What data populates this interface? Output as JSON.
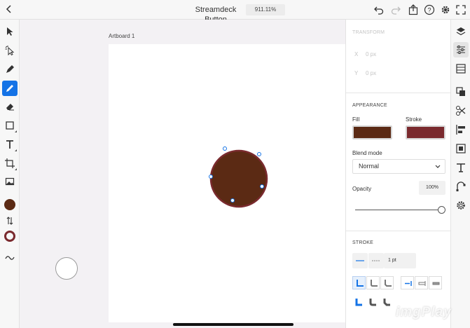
{
  "header": {
    "title": "Streamdeck Button",
    "zoom": "911.11%"
  },
  "canvas": {
    "artboard_label": "Artboard 1"
  },
  "colors": {
    "fill": "#5b2a14",
    "stroke": "#7a2a2e",
    "accent": "#1473e6"
  },
  "transform": {
    "title": "TRANSFORM",
    "x_label": "X",
    "x_value": "0 px",
    "y_label": "Y",
    "y_value": "0 px"
  },
  "appearance": {
    "title": "APPEARANCE",
    "fill_label": "Fill",
    "stroke_label": "Stroke",
    "blend_label": "Blend mode",
    "blend_value": "Normal",
    "opacity_label": "Opacity",
    "opacity_value": "100%"
  },
  "stroke": {
    "title": "STROKE",
    "width": "1 pt"
  },
  "watermark": "imgPlay"
}
